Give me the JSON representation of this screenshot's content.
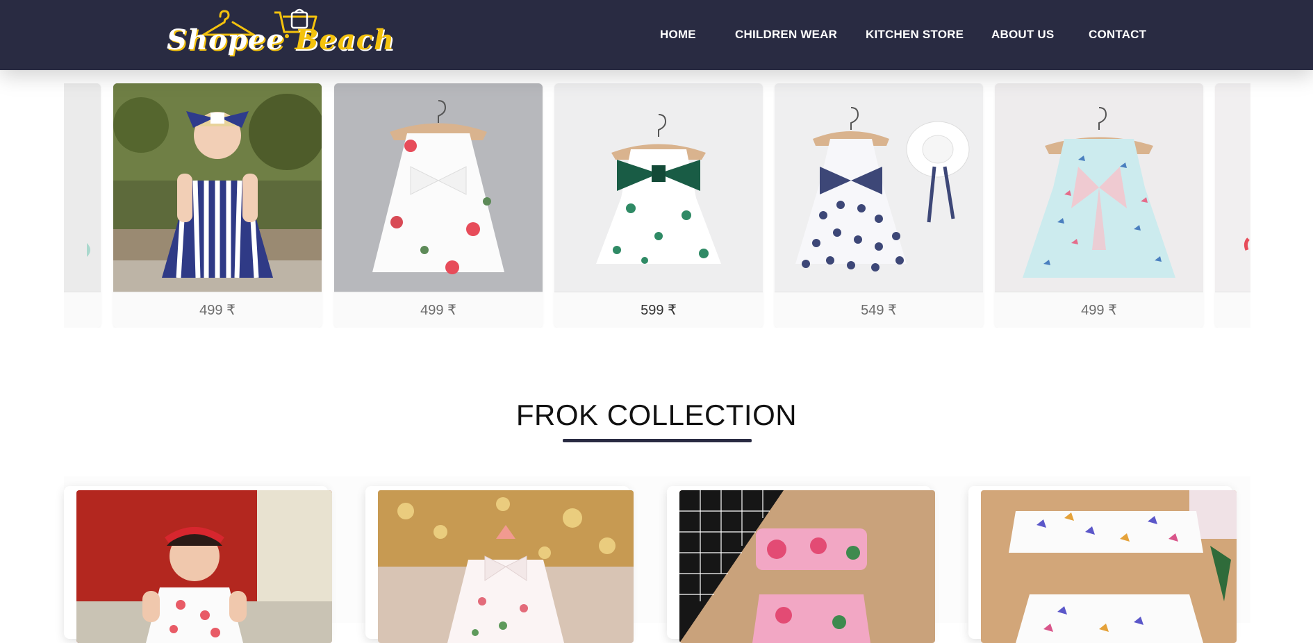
{
  "brand": {
    "logo_text_1": "Shopee",
    "logo_text_2": "Beach",
    "logo_icon": "hanger-cart-logo"
  },
  "nav": [
    {
      "label": "HOME"
    },
    {
      "label": "CHILDREN WEAR"
    },
    {
      "label": "KITCHEN STORE"
    },
    {
      "label": "ABOUT US"
    },
    {
      "label": "CONTACT"
    }
  ],
  "carousel": {
    "items": [
      {
        "price": "499 ₹",
        "image": "girl-striped-dress-photo"
      },
      {
        "price": "499 ₹",
        "image": "white-floral-bow-dress"
      },
      {
        "price": "599 ₹",
        "image": "white-polka-green-bow-dress"
      },
      {
        "price": "549 ₹",
        "image": "navy-polka-dress-with-hat"
      },
      {
        "price": "499 ₹",
        "image": "mint-print-pink-bow-dress"
      }
    ]
  },
  "section": {
    "title": "FROK COLLECTION"
  },
  "grid": {
    "items": [
      {
        "image": "baby-pink-floral-dress-photo"
      },
      {
        "image": "floral-dress-chandelier-photo"
      },
      {
        "image": "pink-floral-two-piece-set"
      },
      {
        "image": "butterfly-print-two-piece-set"
      }
    ]
  },
  "colors": {
    "header": "#292b42",
    "accent": "#f4c20d",
    "rule": "#292b42"
  }
}
